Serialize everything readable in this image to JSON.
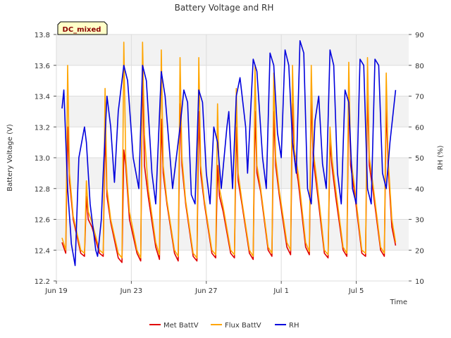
{
  "chart_data": {
    "type": "line",
    "title": "Battery Voltage and RH",
    "xlabel": "Time",
    "ylabel": "Battery Voltage (V)",
    "y2label": "RH (%)",
    "badge": "DC_mixed",
    "xlim": [
      0,
      18.8
    ],
    "ylim": [
      12.2,
      13.8
    ],
    "y2lim": [
      10,
      90
    ],
    "x_ticks": [
      {
        "value": 0,
        "label": "Jun 19"
      },
      {
        "value": 4,
        "label": "Jun 23"
      },
      {
        "value": 8,
        "label": "Jun 27"
      },
      {
        "value": 12,
        "label": "Jul 1"
      },
      {
        "value": 16,
        "label": "Jul 5"
      }
    ],
    "y_ticks": [
      "12.2",
      "12.4",
      "12.6",
      "12.8",
      "13.0",
      "13.2",
      "13.4",
      "13.6",
      "13.8"
    ],
    "y2_ticks": [
      "10",
      "20",
      "30",
      "40",
      "50",
      "60",
      "70",
      "80",
      "90"
    ],
    "grid": true,
    "legend_position": "bottom",
    "series": [
      {
        "name": "Met BattV",
        "axis": "left",
        "color": "#e00000",
        "x": [
          0.3,
          0.5,
          0.6,
          0.7,
          0.9,
          1.3,
          1.5,
          1.6,
          1.7,
          1.9,
          2.3,
          2.5,
          2.6,
          2.7,
          2.9,
          3.3,
          3.5,
          3.6,
          3.7,
          3.9,
          4.3,
          4.5,
          4.6,
          4.7,
          4.9,
          5.3,
          5.5,
          5.6,
          5.7,
          5.9,
          6.3,
          6.5,
          6.6,
          6.7,
          6.9,
          7.3,
          7.5,
          7.6,
          7.7,
          7.9,
          8.3,
          8.5,
          8.6,
          8.7,
          8.9,
          9.3,
          9.5,
          9.6,
          9.7,
          9.9,
          10.3,
          10.5,
          10.6,
          10.7,
          10.9,
          11.3,
          11.5,
          11.6,
          11.7,
          11.9,
          12.3,
          12.5,
          12.6,
          12.7,
          12.9,
          13.3,
          13.5,
          13.6,
          13.7,
          13.9,
          14.3,
          14.5,
          14.6,
          14.7,
          14.9,
          15.3,
          15.5,
          15.6,
          15.7,
          15.9,
          16.3,
          16.5,
          16.6,
          16.7,
          16.9,
          17.3,
          17.5,
          17.6,
          17.7,
          17.9,
          18.1
        ],
        "values": [
          12.45,
          12.38,
          13.2,
          12.85,
          12.6,
          12.38,
          12.36,
          12.75,
          12.6,
          12.55,
          12.38,
          12.36,
          13.2,
          12.75,
          12.58,
          12.35,
          12.32,
          13.05,
          12.95,
          12.6,
          12.38,
          12.33,
          13.6,
          12.95,
          12.75,
          12.42,
          12.34,
          13.25,
          12.9,
          12.7,
          12.38,
          12.33,
          13.35,
          12.95,
          12.7,
          12.36,
          12.33,
          13.3,
          12.9,
          12.7,
          12.38,
          12.35,
          12.95,
          12.75,
          12.65,
          12.38,
          12.35,
          13.2,
          12.85,
          12.7,
          12.38,
          12.34,
          13.3,
          12.9,
          12.78,
          12.4,
          12.36,
          13.3,
          12.95,
          12.75,
          12.42,
          12.37,
          13.35,
          13.0,
          12.85,
          12.42,
          12.37,
          13.4,
          13.0,
          12.8,
          12.38,
          12.35,
          13.1,
          12.95,
          12.75,
          12.4,
          12.36,
          13.4,
          12.95,
          12.78,
          12.38,
          12.36,
          13.45,
          12.95,
          12.78,
          12.4,
          12.36,
          13.35,
          12.95,
          12.55,
          12.43
        ]
      },
      {
        "name": "Flux BattV",
        "axis": "left",
        "color": "#ffa500",
        "x": [
          0.3,
          0.5,
          0.6,
          0.7,
          0.9,
          1.3,
          1.5,
          1.6,
          1.7,
          1.9,
          2.3,
          2.5,
          2.6,
          2.7,
          2.9,
          3.3,
          3.5,
          3.6,
          3.7,
          3.9,
          4.3,
          4.5,
          4.6,
          4.7,
          4.9,
          5.3,
          5.5,
          5.6,
          5.7,
          5.9,
          6.3,
          6.5,
          6.6,
          6.7,
          6.9,
          7.3,
          7.5,
          7.6,
          7.7,
          7.9,
          8.3,
          8.5,
          8.6,
          8.7,
          8.9,
          9.3,
          9.5,
          9.6,
          9.7,
          9.9,
          10.3,
          10.5,
          10.6,
          10.7,
          10.9,
          11.3,
          11.5,
          11.6,
          11.7,
          11.9,
          12.3,
          12.5,
          12.6,
          12.7,
          12.9,
          13.3,
          13.5,
          13.6,
          13.7,
          13.9,
          14.3,
          14.5,
          14.6,
          14.7,
          14.9,
          15.3,
          15.5,
          15.6,
          15.7,
          15.9,
          16.3,
          16.5,
          16.6,
          16.7,
          16.9,
          17.3,
          17.5,
          17.6,
          17.7,
          17.9,
          18.1
        ],
        "values": [
          12.48,
          12.4,
          13.6,
          12.9,
          12.62,
          12.4,
          12.38,
          12.85,
          12.65,
          12.58,
          12.4,
          12.38,
          13.45,
          12.8,
          12.6,
          12.38,
          12.35,
          13.75,
          13.0,
          12.65,
          12.4,
          12.35,
          13.75,
          13.15,
          12.8,
          12.45,
          12.37,
          13.7,
          12.95,
          12.72,
          12.4,
          12.36,
          13.65,
          13.0,
          12.72,
          12.38,
          12.35,
          13.65,
          12.95,
          12.72,
          12.4,
          12.37,
          13.35,
          12.8,
          12.68,
          12.4,
          12.37,
          13.45,
          12.9,
          12.72,
          12.4,
          12.36,
          13.6,
          12.95,
          12.8,
          12.42,
          12.38,
          13.55,
          13.0,
          12.78,
          12.45,
          12.4,
          13.6,
          13.05,
          12.9,
          12.45,
          12.39,
          13.6,
          13.05,
          12.85,
          12.4,
          12.37,
          13.2,
          13.0,
          12.8,
          12.42,
          12.38,
          13.62,
          13.0,
          12.82,
          12.4,
          12.38,
          13.65,
          13.0,
          12.82,
          12.42,
          12.38,
          13.55,
          13.0,
          12.6,
          12.45
        ]
      },
      {
        "name": "RH",
        "axis": "right",
        "color": "#0000dd",
        "x": [
          0.3,
          0.4,
          0.6,
          0.8,
          1.0,
          1.2,
          1.5,
          1.6,
          1.8,
          2.1,
          2.2,
          2.4,
          2.5,
          2.7,
          2.9,
          3.1,
          3.3,
          3.6,
          3.8,
          4.1,
          4.4,
          4.6,
          4.8,
          5.1,
          5.3,
          5.6,
          5.8,
          6.0,
          6.2,
          6.4,
          6.6,
          6.8,
          7.0,
          7.2,
          7.4,
          7.6,
          7.8,
          8.0,
          8.2,
          8.4,
          8.6,
          8.8,
          9.1,
          9.2,
          9.4,
          9.6,
          9.8,
          10.1,
          10.2,
          10.5,
          10.7,
          11.0,
          11.2,
          11.4,
          11.6,
          11.8,
          12.0,
          12.2,
          12.4,
          12.6,
          12.8,
          13.0,
          13.2,
          13.4,
          13.6,
          13.8,
          14.0,
          14.2,
          14.4,
          14.6,
          14.8,
          15.0,
          15.2,
          15.4,
          15.6,
          15.8,
          16.0,
          16.2,
          16.4,
          16.6,
          16.8,
          17.0,
          17.2,
          17.4,
          17.6,
          17.8,
          18.1
        ],
        "values": [
          66,
          72,
          40,
          22,
          15,
          50,
          60,
          55,
          35,
          20,
          18,
          30,
          45,
          70,
          60,
          42,
          65,
          80,
          75,
          50,
          40,
          80,
          75,
          45,
          35,
          78,
          70,
          55,
          40,
          50,
          60,
          72,
          68,
          38,
          35,
          72,
          68,
          45,
          35,
          60,
          55,
          40,
          60,
          65,
          40,
          70,
          76,
          60,
          45,
          82,
          78,
          50,
          40,
          84,
          80,
          58,
          50,
          85,
          80,
          55,
          45,
          88,
          84,
          40,
          35,
          62,
          70,
          48,
          40,
          85,
          80,
          45,
          35,
          72,
          68,
          40,
          35,
          82,
          80,
          40,
          35,
          82,
          80,
          45,
          40,
          55,
          72
        ]
      }
    ]
  }
}
